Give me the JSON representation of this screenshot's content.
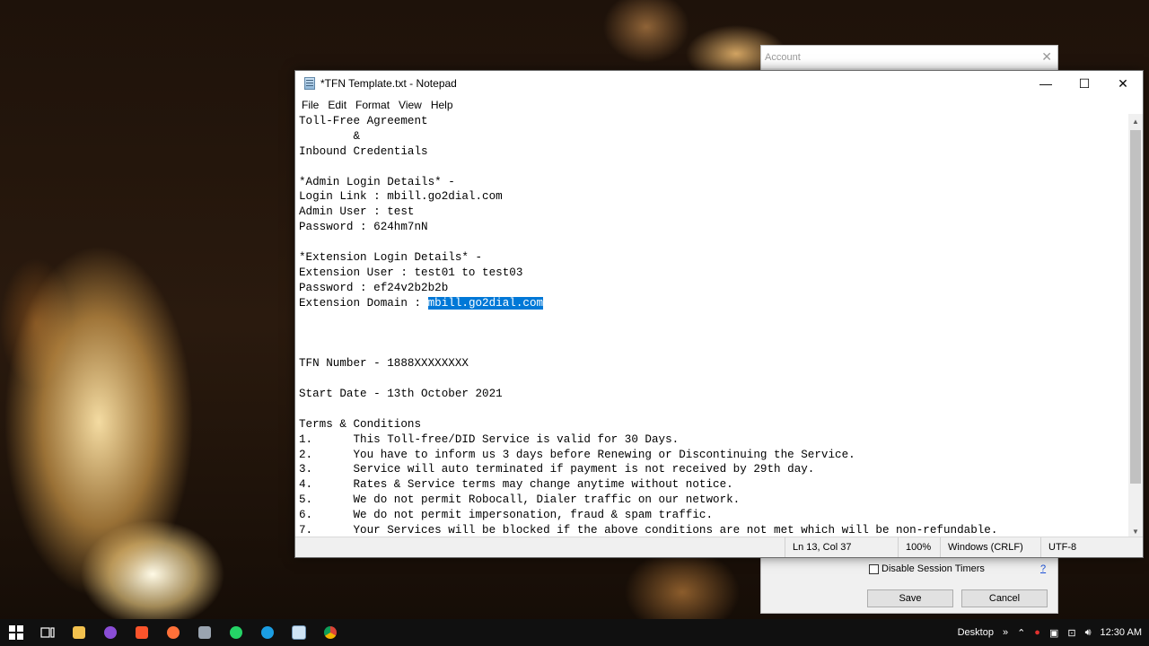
{
  "account_dialog": {
    "title": "Account",
    "close": "✕",
    "disable_session_label": "Disable Session Timers",
    "help": "?",
    "save_label": "Save",
    "cancel_label": "Cancel"
  },
  "notepad": {
    "title": "*TFN Template.txt - Notepad",
    "controls": {
      "minimize": "—",
      "maximize": "☐",
      "close": "✕"
    },
    "menu": [
      "File",
      "Edit",
      "Format",
      "View",
      "Help"
    ],
    "lines": [
      "Toll-Free Agreement",
      "        &",
      "Inbound Credentials",
      "",
      "*Admin Login Details* -",
      "Login Link : mbill.go2dial.com",
      "Admin User : test",
      "Password : 624hm7nN",
      "",
      "*Extension Login Details* -",
      "Extension User : test01 to test03",
      "Password : ef24v2b2b2b",
      "",
      "",
      "",
      "TFN Number - 1888XXXXXXXX",
      "",
      "Start Date - 13th October 2021",
      "",
      "Terms & Conditions",
      "1.      This Toll-free/DID Service is valid for 30 Days.",
      "2.      You have to inform us 3 days before Renewing or Discontinuing the Service.",
      "3.      Service will auto terminated if payment is not received by 29th day.",
      "4.      Rates & Service terms may change anytime without notice.",
      "5.      We do not permit Robocall, Dialer traffic on our network.",
      "6.      We do not permit impersonation, fraud & spam traffic.",
      "7.      Your Services will be blocked if the above conditions are not met which will be non-refundable."
    ],
    "selected_line_prefix": "Extension Domain : ",
    "selected_text": "mbill.go2dial.com",
    "status": {
      "position": "Ln 13, Col 37",
      "zoom": "100%",
      "line_ending": "Windows (CRLF)",
      "encoding": "UTF-8"
    }
  },
  "taskbar": {
    "icons": [
      "windows-start-icon",
      "task-view-icon",
      "file-explorer-icon",
      "messenger-icon",
      "brave-icon",
      "firefox-icon",
      "tools-icon",
      "whatsapp-icon",
      "edge-icon",
      "notepad-icon",
      "chrome-icon"
    ],
    "desktop_label": "Desktop",
    "chevron": "»",
    "time": "12:30 AM"
  }
}
